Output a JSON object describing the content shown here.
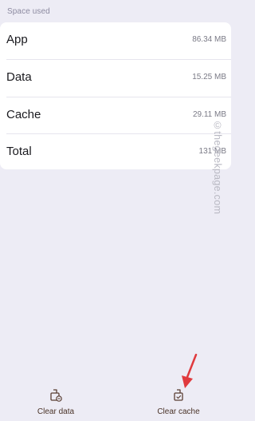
{
  "section": {
    "title": "Space used"
  },
  "rows": [
    {
      "label": "App",
      "value": "86.34 MB"
    },
    {
      "label": "Data",
      "value": "15.25 MB"
    },
    {
      "label": "Cache",
      "value": "29.11 MB"
    },
    {
      "label": "Total",
      "value": "131 MB"
    }
  ],
  "watermark": "©thegeekpage.com",
  "actions": {
    "clear_data": "Clear data",
    "clear_cache": "Clear cache"
  },
  "colors": {
    "background": "#edecf5",
    "card": "#ffffff",
    "action_icon": "#5a3e33",
    "annotation_arrow": "#e03a3e"
  },
  "icons": {
    "clear_data": "clear-data-icon",
    "clear_cache": "clear-cache-icon",
    "annotation": "red-arrow-icon"
  }
}
